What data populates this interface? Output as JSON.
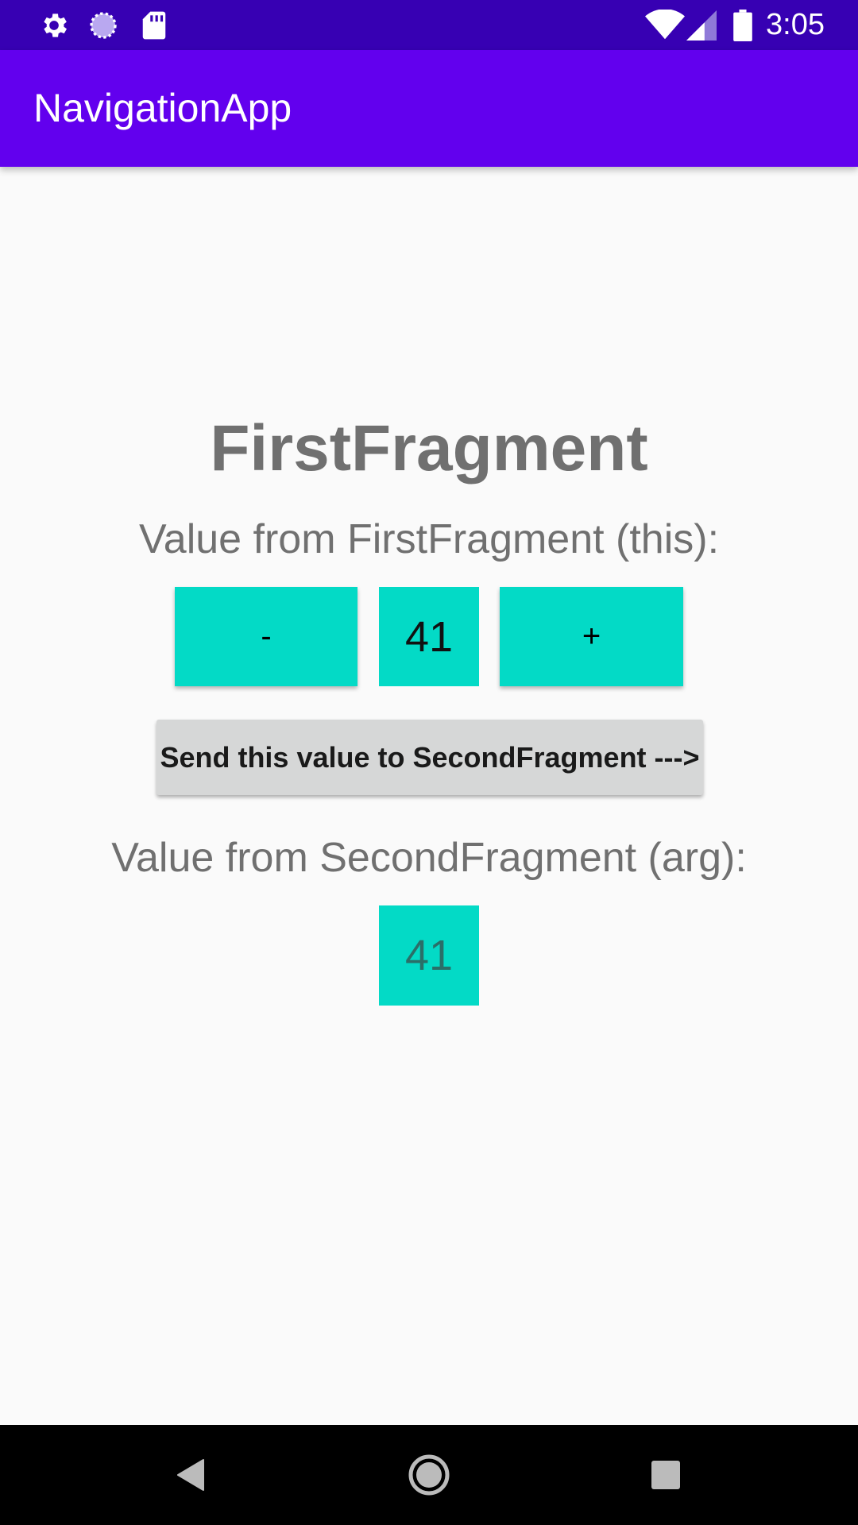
{
  "status_bar": {
    "time": "3:05",
    "icons": [
      "gear-icon",
      "sync-icon",
      "sd-card-icon",
      "wifi-icon",
      "signal-icon",
      "battery-icon"
    ]
  },
  "app_bar": {
    "title": "NavigationApp",
    "color": "#6200ee"
  },
  "content": {
    "fragment_title": "FirstFragment",
    "first_label": "Value from FirstFragment (this):",
    "minus_label": "-",
    "counter_value": "41",
    "plus_label": "+",
    "send_button_label": "Send this value to SecondFragment --->",
    "second_label": "Value from SecondFragment (arg):",
    "arg_value": "41",
    "accent_color": "#03dac6"
  },
  "nav_bar": {
    "buttons": [
      "back-icon",
      "home-icon",
      "recents-icon"
    ]
  }
}
